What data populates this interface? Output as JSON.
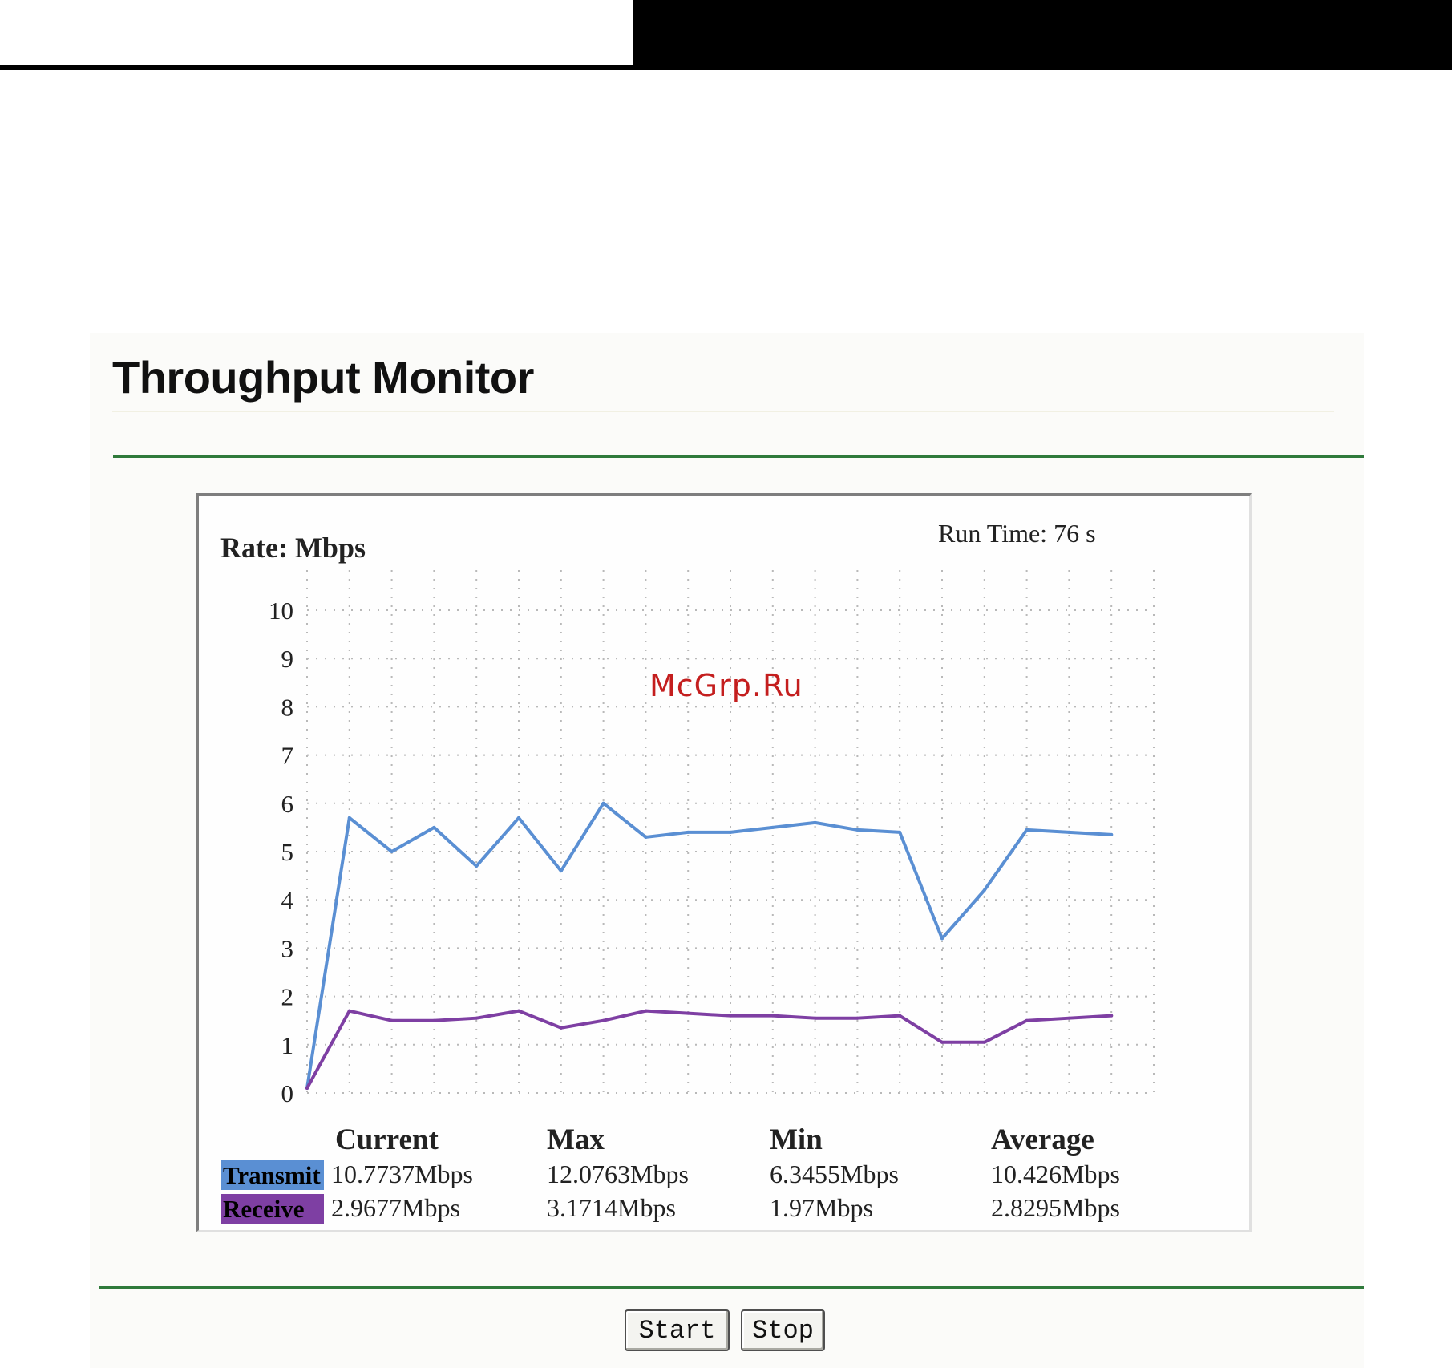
{
  "page": {
    "title": "Throughput Monitor"
  },
  "graph": {
    "rate_label": "Rate: Mbps",
    "run_time_label": "Run Time:",
    "run_time_value": "76",
    "run_time_unit": "s",
    "watermark": "McGrp.Ru"
  },
  "chart_data": {
    "type": "line",
    "title": "",
    "ylabel": "Rate: Mbps",
    "ylim": [
      0,
      10
    ],
    "yticks": [
      "0",
      "1",
      "2",
      "3",
      "4",
      "5",
      "6",
      "7",
      "8",
      "9",
      "10"
    ],
    "x": [
      0,
      1,
      2,
      3,
      4,
      5,
      6,
      7,
      8,
      9,
      10,
      11,
      12,
      13,
      14,
      15,
      16,
      17,
      18,
      19
    ],
    "xlim": [
      0,
      20
    ],
    "grid": true,
    "series": [
      {
        "name": "Transmit",
        "color": "#5a8fd3",
        "values": [
          0.1,
          5.7,
          5.0,
          5.5,
          4.7,
          5.7,
          4.6,
          6.0,
          5.3,
          5.4,
          5.4,
          5.5,
          5.6,
          5.45,
          5.4,
          3.2,
          4.2,
          5.45,
          5.4,
          5.35
        ]
      },
      {
        "name": "Receive",
        "color": "#7e3fa3",
        "values": [
          0.1,
          1.7,
          1.5,
          1.5,
          1.55,
          1.7,
          1.35,
          1.5,
          1.7,
          1.65,
          1.6,
          1.6,
          1.55,
          1.55,
          1.6,
          1.05,
          1.05,
          1.5,
          1.55,
          1.6
        ]
      }
    ]
  },
  "stats": {
    "headers": [
      "Current",
      "Max",
      "Min",
      "Average"
    ],
    "transmit": {
      "label": "Transmit",
      "color": "#5a8fd3",
      "values": [
        "10.7737Mbps",
        "12.0763Mbps",
        "6.3455Mbps",
        "10.426Mbps"
      ]
    },
    "receive": {
      "label": "Receive",
      "color": "#7e3fa3",
      "values": [
        "2.9677Mbps",
        "3.1714Mbps",
        "1.97Mbps",
        "2.8295Mbps"
      ]
    }
  },
  "buttons": {
    "start": "Start",
    "stop": "Stop"
  }
}
